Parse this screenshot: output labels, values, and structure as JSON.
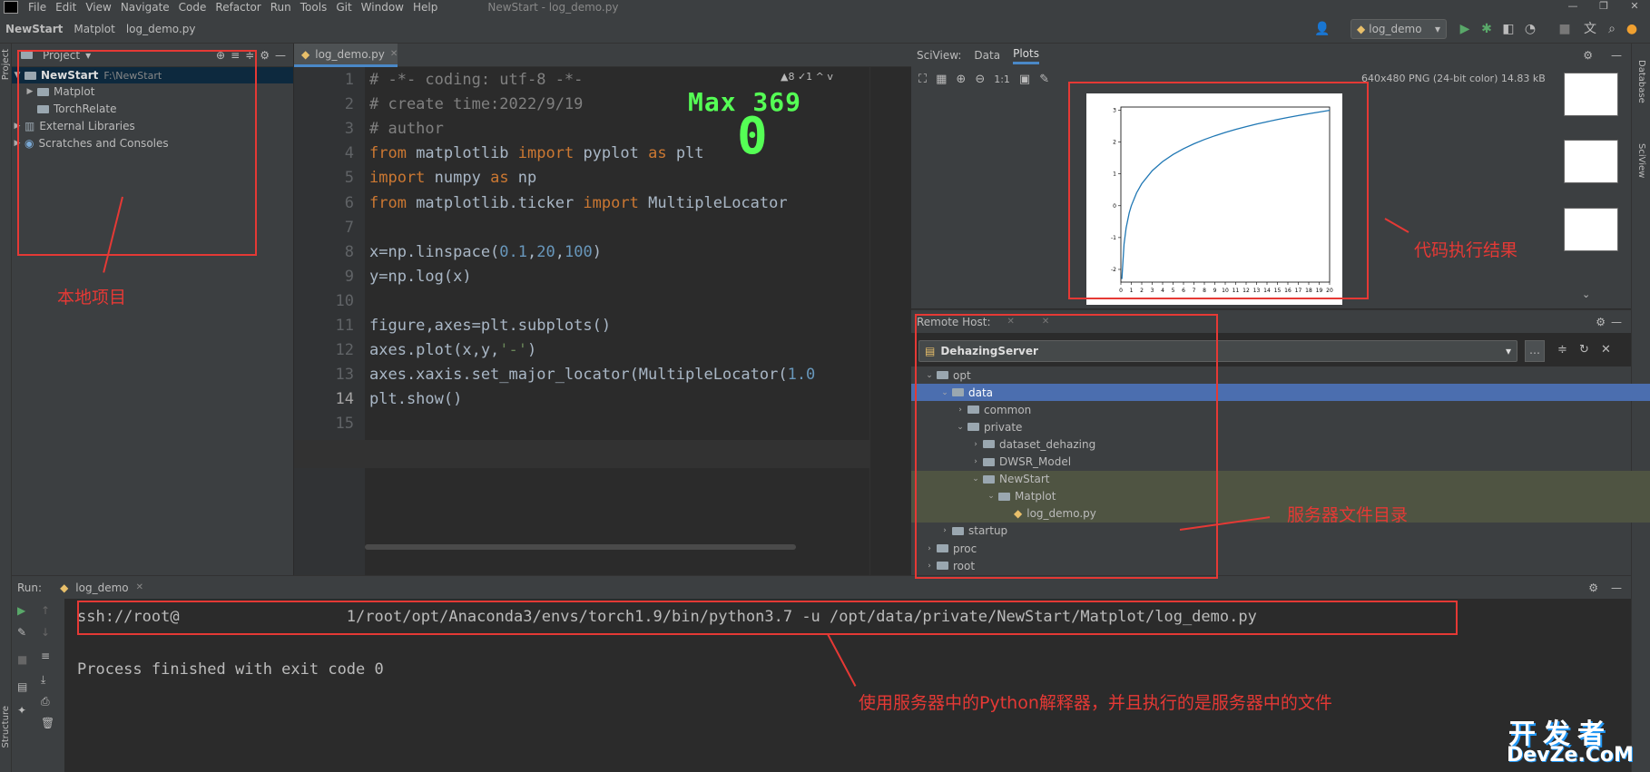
{
  "menu": {
    "items": [
      "File",
      "Edit",
      "View",
      "Navigate",
      "Code",
      "Refactor",
      "Run",
      "Tools",
      "Git",
      "Window",
      "Help"
    ],
    "window_title": "NewStart - log_demo.py"
  },
  "breadcrumb": [
    "NewStart",
    "Matplot",
    "log_demo.py"
  ],
  "run_config": "log_demo",
  "project": {
    "title": "Project",
    "tree": [
      {
        "label": "NewStart",
        "path": "F:\\NewStart"
      },
      {
        "label": "Matplot"
      },
      {
        "label": "TorchRelate"
      },
      {
        "label": "External Libraries"
      },
      {
        "label": "Scratches and Consoles"
      }
    ]
  },
  "sidebar_labels": {
    "project": "Project",
    "structure": "Structure",
    "database": "Database",
    "sciview": "SciView"
  },
  "editor": {
    "tab": "log_demo.py",
    "inspections": "▲8 ✓1 ^ v",
    "line_numbers": [
      "1",
      "2",
      "3",
      "4",
      "5",
      "6",
      "7",
      "8",
      "9",
      "10",
      "11",
      "12",
      "13",
      "14",
      "15"
    ],
    "lines": [
      "# -*- coding: utf-8 -*-",
      "# create time:2022/9/19",
      "# author",
      "from matplotlib import pyplot as plt",
      "import numpy as np",
      "from matplotlib.ticker import MultipleLocator",
      "",
      "x=np.linspace(0.1,20,100)",
      "y=np.log(x)",
      "",
      "figure,axes=plt.subplots()",
      "axes.plot(x,y,'-')",
      "axes.xaxis.set_major_locator(MultipleLocator(1.0",
      "plt.show()",
      ""
    ],
    "overlay_max_label": "Max 369",
    "overlay_value": "0"
  },
  "sciview": {
    "title": "SciView:",
    "tabs": [
      "Data",
      "Plots"
    ],
    "image_info": "640x480 PNG (24-bit color) 14.83 kB",
    "zoom_label": "1:1"
  },
  "chart_data": {
    "type": "line",
    "title": "",
    "xlabel": "",
    "ylabel": "",
    "x_ticks": [
      "0",
      "1",
      "2",
      "3",
      "4",
      "5",
      "6",
      "7",
      "8",
      "9",
      "10",
      "11",
      "12",
      "13",
      "14",
      "15",
      "16",
      "17",
      "18",
      "19",
      "20"
    ],
    "y_ticks": [
      "3",
      "2",
      "1",
      "0",
      "-1",
      "-2"
    ],
    "xlim": [
      0,
      20
    ],
    "ylim": [
      -2.4,
      3.1
    ],
    "series": [
      {
        "color": "#1f77b4",
        "x": [
          0.1,
          0.3,
          0.5,
          0.8,
          1.0,
          1.5,
          2,
          3,
          4,
          5,
          6,
          7,
          8,
          9,
          10,
          11,
          12,
          13,
          14,
          15,
          16,
          17,
          18,
          19,
          20
        ],
        "y": [
          -2.303,
          -1.204,
          -0.693,
          -0.223,
          0.0,
          0.405,
          0.693,
          1.099,
          1.386,
          1.609,
          1.792,
          1.946,
          2.079,
          2.197,
          2.303,
          2.398,
          2.485,
          2.565,
          2.639,
          2.708,
          2.773,
          2.833,
          2.89,
          2.944,
          2.996
        ]
      }
    ]
  },
  "remote_host": {
    "title": "Remote Host:",
    "server": "DehazingServer",
    "tree": [
      {
        "label": "opt",
        "depth": 1,
        "arrow": "v"
      },
      {
        "label": "data",
        "depth": 2,
        "arrow": "v"
      },
      {
        "label": "common",
        "depth": 3,
        "arrow": ">"
      },
      {
        "label": "private",
        "depth": 3,
        "arrow": "v"
      },
      {
        "label": "dataset_dehazing",
        "depth": 4,
        "arrow": ">"
      },
      {
        "label": "DWSR_Model",
        "depth": 4,
        "arrow": ">"
      },
      {
        "label": "NewStart",
        "depth": 4,
        "arrow": "v"
      },
      {
        "label": "Matplot",
        "depth": 5,
        "arrow": "v"
      },
      {
        "label": "log_demo.py",
        "depth": 6,
        "arrow": ""
      },
      {
        "label": "startup",
        "depth": 2,
        "arrow": ">"
      },
      {
        "label": "proc",
        "depth": 1,
        "arrow": ">"
      },
      {
        "label": "root",
        "depth": 1,
        "arrow": ">"
      }
    ]
  },
  "run": {
    "label": "Run:",
    "tab": "log_demo",
    "command": "ssh://root@                  1/root/opt/Anaconda3/envs/torch1.9/bin/python3.7 -u /opt/data/private/NewStart/Matplot/log_demo.py",
    "exit_message": "Process finished with exit code 0"
  },
  "annotations": {
    "local_project": "本地项目",
    "execution_result": "代码执行结果",
    "server_dir": "服务器文件目录",
    "interpreter_note": "使用服务器中的Python解释器，并且执行的是服务器中的文件",
    "color": "#e53935"
  },
  "watermark": {
    "line1": "开发者",
    "line2": "DevZe.CoM"
  }
}
